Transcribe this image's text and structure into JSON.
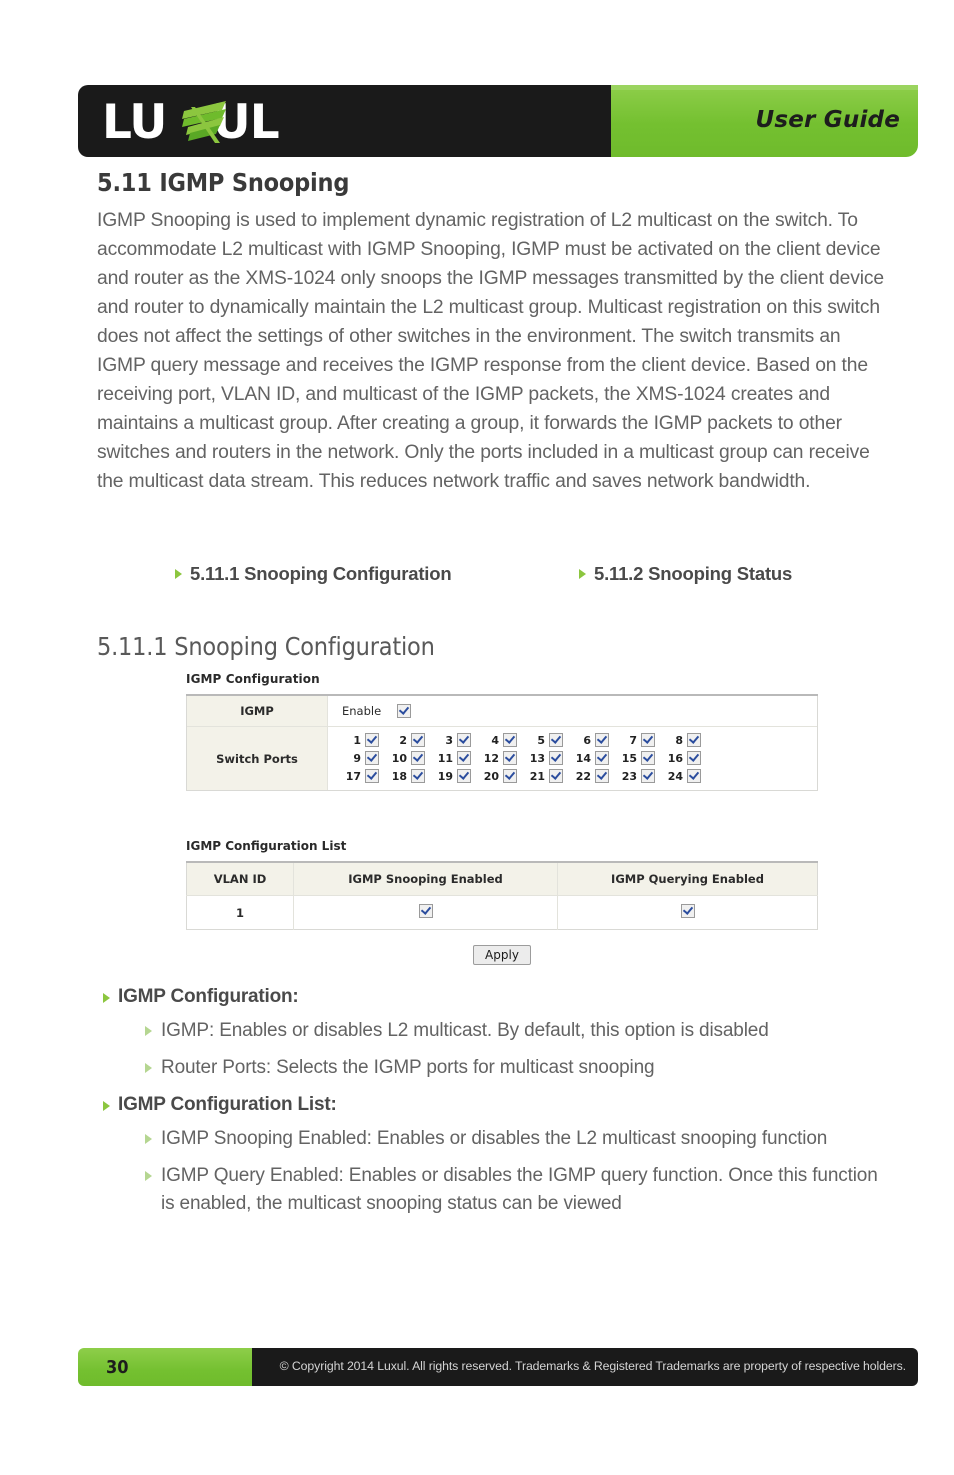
{
  "header": {
    "logo_text": "LUXUL",
    "logo_x_letter": "X",
    "user_guide_label": "User Guide"
  },
  "main": {
    "section_number_title": "5.11 IGMP Snooping",
    "intro_paragraph": "IGMP Snooping is used to implement dynamic registration of L2 multicast on the switch. To accommodate L2 multicast with IGMP Snooping, IGMP must be activated on the client device and router as the XMS-1024 only snoops the IGMP messages transmitted by the client device and router to dynamically maintain the L2 multicast group. Multicast registration on this switch does not affect the settings of other switches in the environment. The switch transmits an IGMP query message and receives the IGMP response from the client device. Based on the receiving port, VLAN ID, and multicast of the IGMP packets, the XMS-1024 creates and maintains a multicast group. After creating a group, it forwards the IGMP packets to other switches and routers in the network. Only the ports included in a multicast group can receive the multicast data stream. This reduces network traffic and saves network bandwidth.",
    "links": [
      {
        "label": "5.11.1 Snooping Configuration"
      },
      {
        "label": "5.11.2 Snooping Status"
      }
    ],
    "subsection_title": "5.11.1 Snooping Configuration"
  },
  "ui_screenshot": {
    "igmp_config": {
      "caption": "IGMP Configuration",
      "igmp_row_label": "IGMP",
      "enable_label": "Enable",
      "enable_checked": true,
      "switch_ports_label": "Switch Ports",
      "port_rows": [
        [
          {
            "num": "1",
            "checked": true
          },
          {
            "num": "2",
            "checked": true
          },
          {
            "num": "3",
            "checked": true
          },
          {
            "num": "4",
            "checked": true
          },
          {
            "num": "5",
            "checked": true
          },
          {
            "num": "6",
            "checked": true
          },
          {
            "num": "7",
            "checked": true
          },
          {
            "num": "8",
            "checked": true
          }
        ],
        [
          {
            "num": "9",
            "checked": true
          },
          {
            "num": "10",
            "checked": true
          },
          {
            "num": "11",
            "checked": true
          },
          {
            "num": "12",
            "checked": true
          },
          {
            "num": "13",
            "checked": true
          },
          {
            "num": "14",
            "checked": true
          },
          {
            "num": "15",
            "checked": true
          },
          {
            "num": "16",
            "checked": true
          }
        ],
        [
          {
            "num": "17",
            "checked": true
          },
          {
            "num": "18",
            "checked": true
          },
          {
            "num": "19",
            "checked": true
          },
          {
            "num": "20",
            "checked": true
          },
          {
            "num": "21",
            "checked": true
          },
          {
            "num": "22",
            "checked": true
          },
          {
            "num": "23",
            "checked": true
          },
          {
            "num": "24",
            "checked": true
          }
        ]
      ]
    },
    "igmp_config_list": {
      "caption": "IGMP Configuration List",
      "columns": [
        "VLAN ID",
        "IGMP Snooping Enabled",
        "IGMP Querying Enabled"
      ],
      "rows": [
        {
          "vlan_id": "1",
          "snooping_enabled": true,
          "querying_enabled": true
        }
      ]
    },
    "apply_button_label": "Apply"
  },
  "notes": {
    "group1_title": "IGMP Configuration:",
    "group1_items": [
      "IGMP: Enables or disables L2 multicast. By default, this option is disabled",
      "Router Ports: Selects the IGMP ports for multicast snooping"
    ],
    "group2_title": "IGMP Configuration List:",
    "group2_items": [
      "IGMP Snooping Enabled: Enables or disables the L2 multicast snooping function",
      "IGMP Query Enabled: Enables or disables the IGMP query function. Once this function is enabled, the multicast snooping status can be viewed"
    ]
  },
  "footer": {
    "page_number": "30",
    "copyright": "© Copyright 2014 Luxul. All rights reserved. Trademarks & Registered Trademarks are property of respective holders."
  },
  "colors": {
    "brand_green": "#74c030",
    "brand_black": "#1a1a1a",
    "body_gray": "#636363",
    "bullet_green": "#8cc63f",
    "panel_beige": "#f3f2e9",
    "checkbox_blue": "#2b4d9e"
  }
}
